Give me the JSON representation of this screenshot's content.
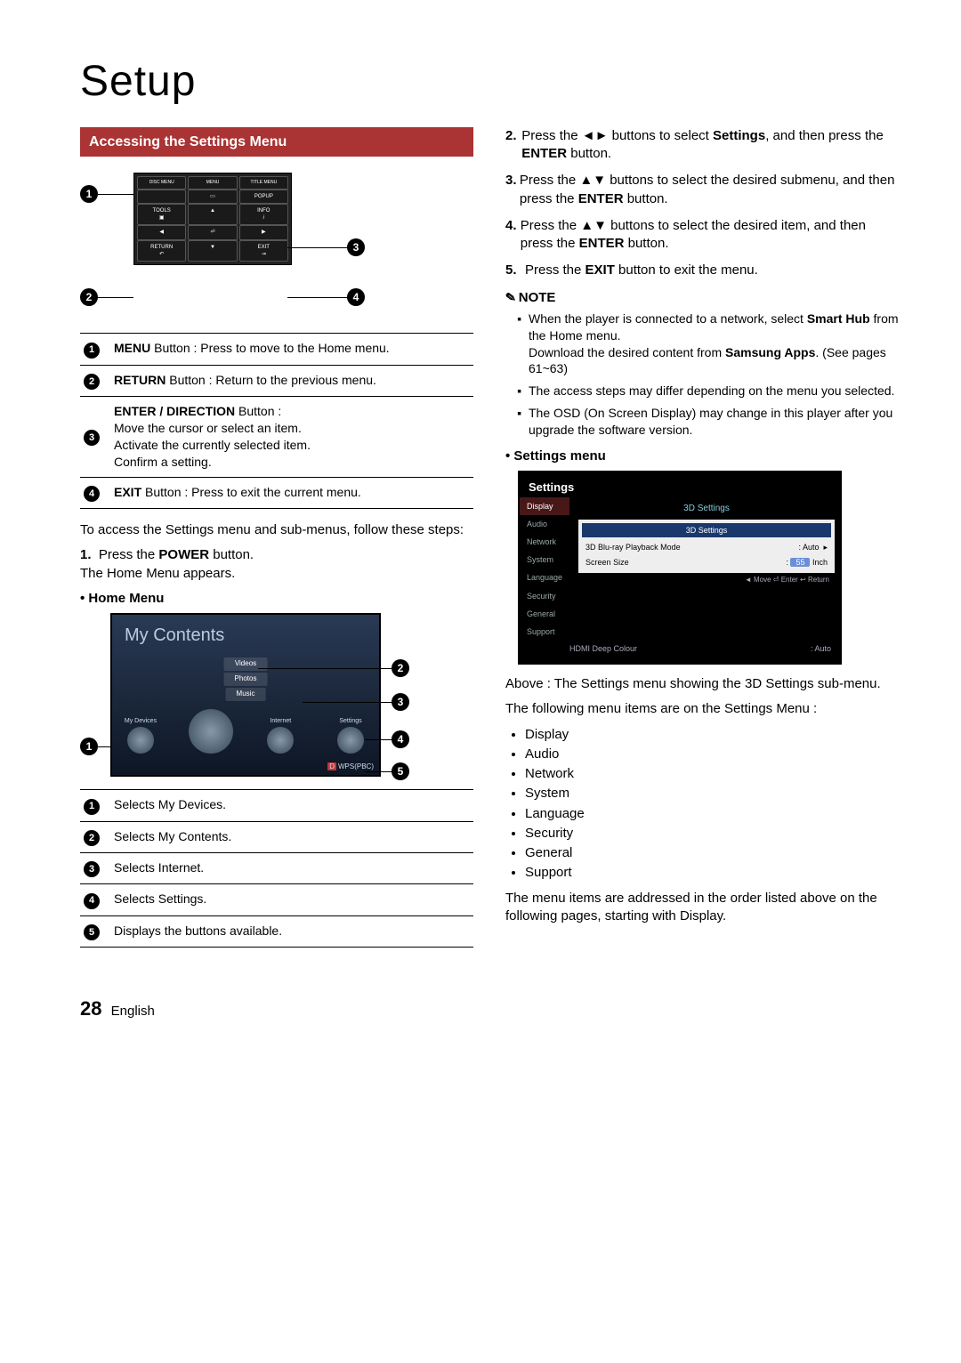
{
  "page": {
    "title": "Setup",
    "number": "28",
    "language": "English"
  },
  "left": {
    "section_header": "Accessing the Settings Menu",
    "remote_labels": {
      "row1a": "DISC MENU",
      "row1b": "MENU",
      "row1c": "TITLE MENU",
      "popup": "POPUP",
      "tools": "TOOLS",
      "info": "INFO",
      "return": "RETURN",
      "exit": "EXIT"
    },
    "callouts": [
      {
        "n": "1",
        "bold": "MENU",
        "rest": " Button : Press to move to the Home menu."
      },
      {
        "n": "2",
        "bold": "RETURN",
        "rest": " Button : Return to the previous menu."
      },
      {
        "n": "3",
        "bold": "ENTER / DIRECTION",
        "rest": " Button :\nMove the cursor or select an item.\nActivate the currently selected item.\nConfirm a setting."
      },
      {
        "n": "4",
        "bold": "EXIT",
        "rest": " Button : Press to exit the current menu."
      }
    ],
    "intro": "To access the Settings menu and sub-menus, follow these steps:",
    "step1_n": "1.",
    "step1_a": "Press the ",
    "step1_bold": "POWER",
    "step1_b": " button.\nThe Home Menu appears.",
    "home_menu_label": "• Home Menu",
    "home_menu": {
      "title": "My Contents",
      "chips": [
        "Videos",
        "Photos",
        "Music"
      ],
      "icons": [
        "My Devices",
        "",
        "Internet",
        "Settings"
      ],
      "wps": "WPS(PBC)"
    },
    "hm_callouts": [
      {
        "n": "1",
        "text": "Selects My Devices."
      },
      {
        "n": "2",
        "text": "Selects My Contents."
      },
      {
        "n": "3",
        "text": "Selects Internet."
      },
      {
        "n": "4",
        "text": "Selects Settings."
      },
      {
        "n": "5",
        "text": "Displays the buttons available."
      }
    ]
  },
  "right": {
    "steps": [
      {
        "n": "2.",
        "pre": "Press the ◄► buttons to select ",
        "b1": "Settings",
        "mid": ", and then press the ",
        "b2": "ENTER",
        "post": " button."
      },
      {
        "n": "3.",
        "pre": "Press the ▲▼ buttons to select the desired submenu, and then press the ",
        "b1": "ENTER",
        "mid": "",
        "b2": "",
        "post": " button."
      },
      {
        "n": "4.",
        "pre": "Press the ▲▼ buttons to select the desired item, and then press the ",
        "b1": "ENTER",
        "mid": "",
        "b2": "",
        "post": " button."
      },
      {
        "n": "5.",
        "pre": "Press the ",
        "b1": "EXIT",
        "mid": "",
        "b2": "",
        "post": " button to exit the menu."
      }
    ],
    "note_label": "NOTE",
    "notes": {
      "n1a": "When the player is connected to a network, select ",
      "n1b": "Smart Hub",
      "n1c": " from the Home menu.\nDownload the desired content from ",
      "n1d": "Samsung Apps",
      "n1e": ". (See pages 61~63)",
      "n2": "The access steps may differ depending on the menu you selected.",
      "n3": "The OSD (On Screen Display) may change in this player after you upgrade the software version."
    },
    "settings_menu_label": "• Settings menu",
    "settings_shot": {
      "title": "Settings",
      "side": [
        "Display",
        "Audio",
        "Network",
        "System",
        "Language",
        "Security",
        "General",
        "Support"
      ],
      "crumb": "3D Settings",
      "popup_title": "3D Settings",
      "row1_l": "3D Blu-ray Playback Mode",
      "row1_r": ": Auto",
      "row2_l": "Screen Size",
      "row2_r_val": "55",
      "row2_r_unit": " Inch",
      "hint": "◄ Move   ⏎ Enter   ↩ Return",
      "last_l": "HDMI Deep Colour",
      "last_r": ": Auto"
    },
    "caption": "Above : The Settings menu showing the 3D Settings sub-menu.",
    "menu_intro": "The following menu items are on the Settings Menu :",
    "menu_items": [
      "Display",
      "Audio",
      "Network",
      "System",
      "Language",
      "Security",
      "General",
      "Support"
    ],
    "closing": "The menu items are addressed in the order listed above on the following pages, starting with Display."
  }
}
